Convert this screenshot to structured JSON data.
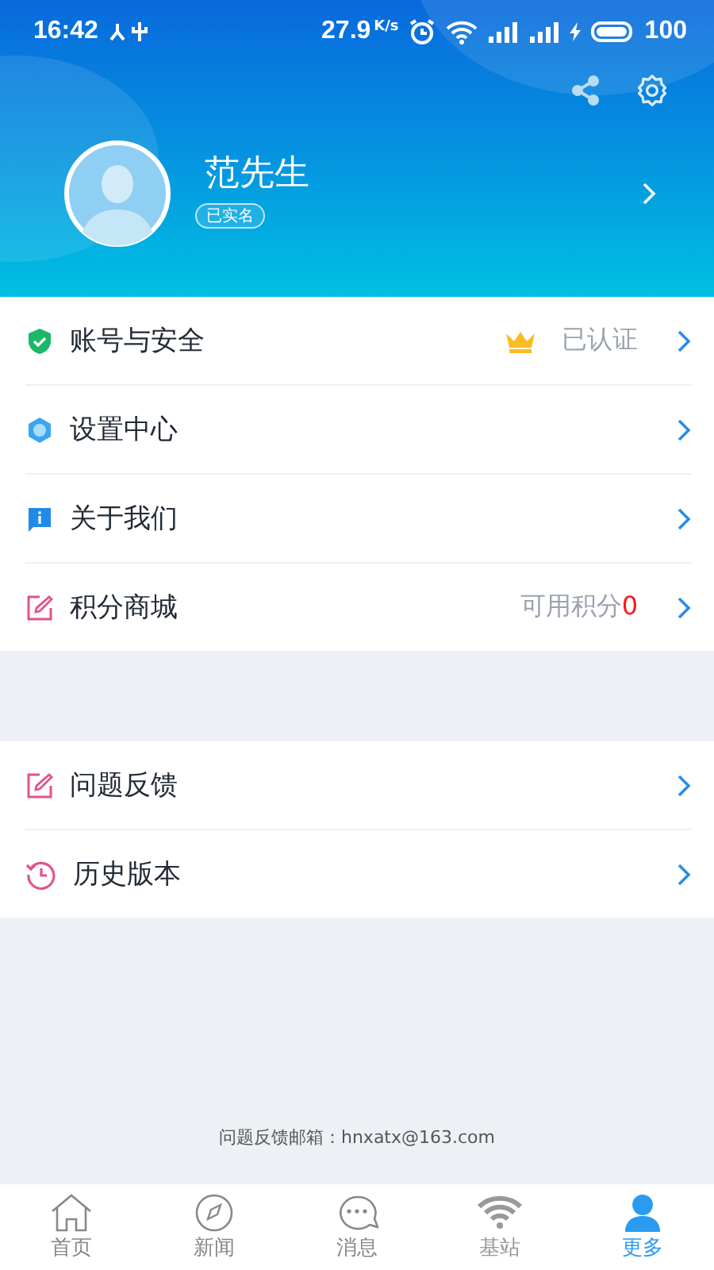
{
  "status_bar": {
    "time": "16:42",
    "speed": "27.9",
    "speed_unit": "K/s",
    "battery": "100"
  },
  "profile": {
    "name": "范先生",
    "badge": "已实名"
  },
  "menu_groups": [
    {
      "items": [
        {
          "label": "账号与安全",
          "crown": true,
          "note": "已认证"
        },
        {
          "label": "设置中心"
        },
        {
          "label": "关于我们"
        },
        {
          "label": "积分商城",
          "note": "可用积分",
          "count": "0"
        }
      ]
    },
    {
      "items": [
        {
          "label": "问题反馈"
        },
        {
          "label": "历史版本"
        }
      ]
    }
  ],
  "footer": "问题反馈邮箱：hnxatx@163.com",
  "tabs": [
    {
      "label": "首页",
      "selected": false
    },
    {
      "label": "新闻",
      "selected": false
    },
    {
      "label": "消息",
      "selected": false
    },
    {
      "label": "基站",
      "selected": false
    },
    {
      "label": "更多",
      "selected": true
    }
  ]
}
